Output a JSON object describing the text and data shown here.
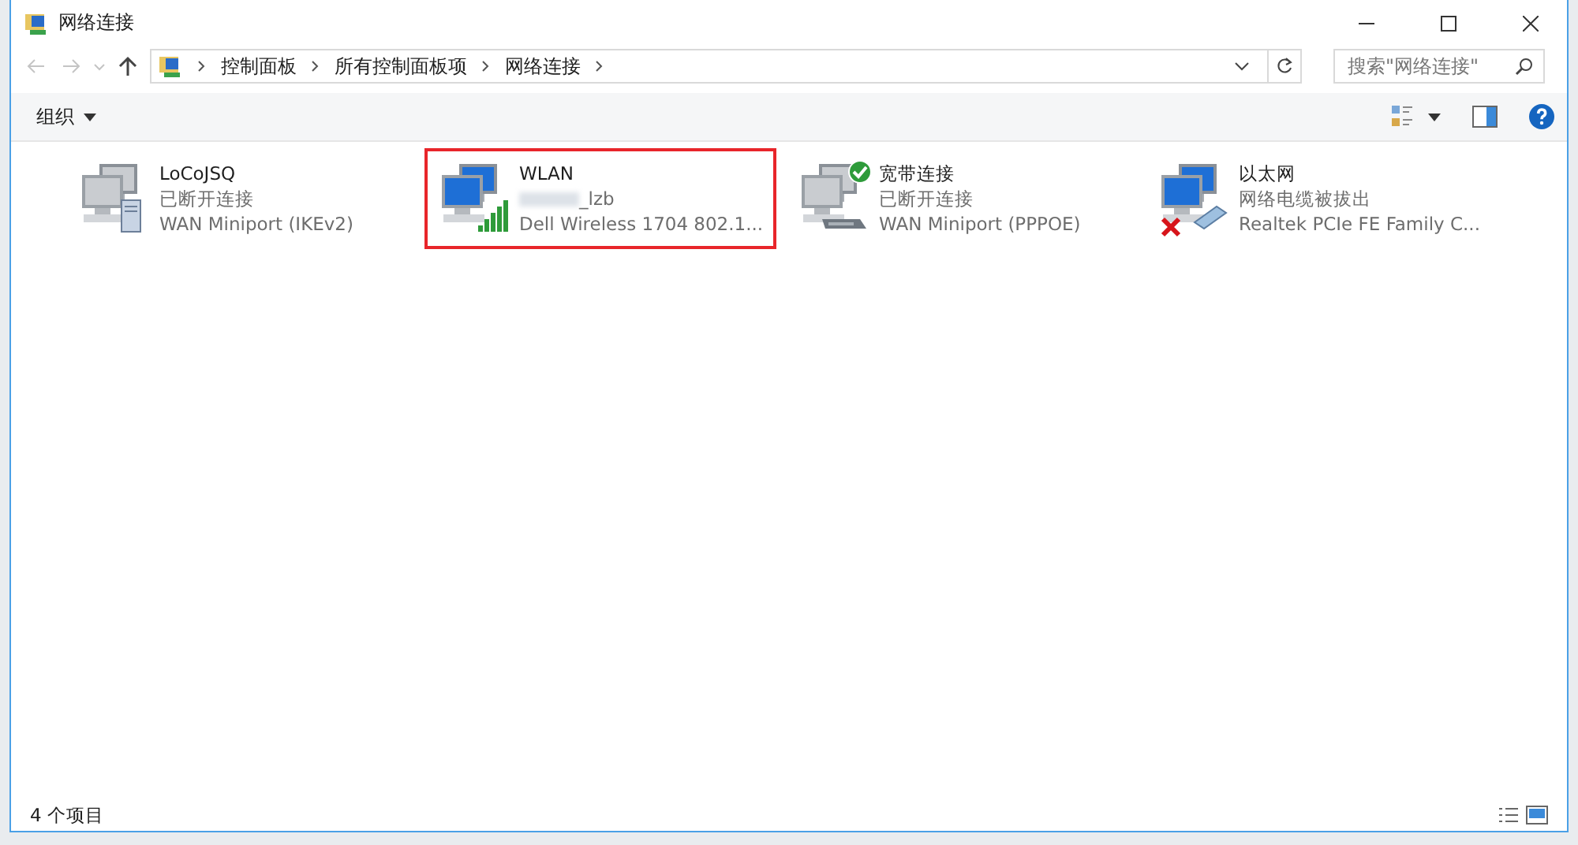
{
  "window": {
    "title": "网络连接"
  },
  "address_bar": {
    "breadcrumbs": [
      "控制面板",
      "所有控制面板项",
      "网络连接"
    ]
  },
  "search": {
    "placeholder": "搜索\"网络连接\""
  },
  "toolbar": {
    "organize": "组织"
  },
  "connections": [
    {
      "name": "LoCoJSQ",
      "status": "已断开连接",
      "device": "WAN Miniport (IKEv2)",
      "kind": "vpn",
      "enabled": false,
      "is_default": false,
      "unplugged": false,
      "highlighted": false
    },
    {
      "name": "WLAN",
      "status": "_lzb",
      "device": "Dell Wireless 1704 802.1...",
      "kind": "wifi",
      "enabled": true,
      "is_default": false,
      "unplugged": false,
      "highlighted": true
    },
    {
      "name": "宽带连接",
      "status": "已断开连接",
      "device": "WAN Miniport (PPPOE)",
      "kind": "dialup",
      "enabled": false,
      "is_default": true,
      "unplugged": false,
      "highlighted": false
    },
    {
      "name": "以太网",
      "status": "网络电缆被拔出",
      "device": "Realtek PCIe FE Family C...",
      "kind": "ethernet",
      "enabled": true,
      "is_default": false,
      "unplugged": true,
      "highlighted": false
    }
  ],
  "status_bar": {
    "count": "4 个项目"
  }
}
